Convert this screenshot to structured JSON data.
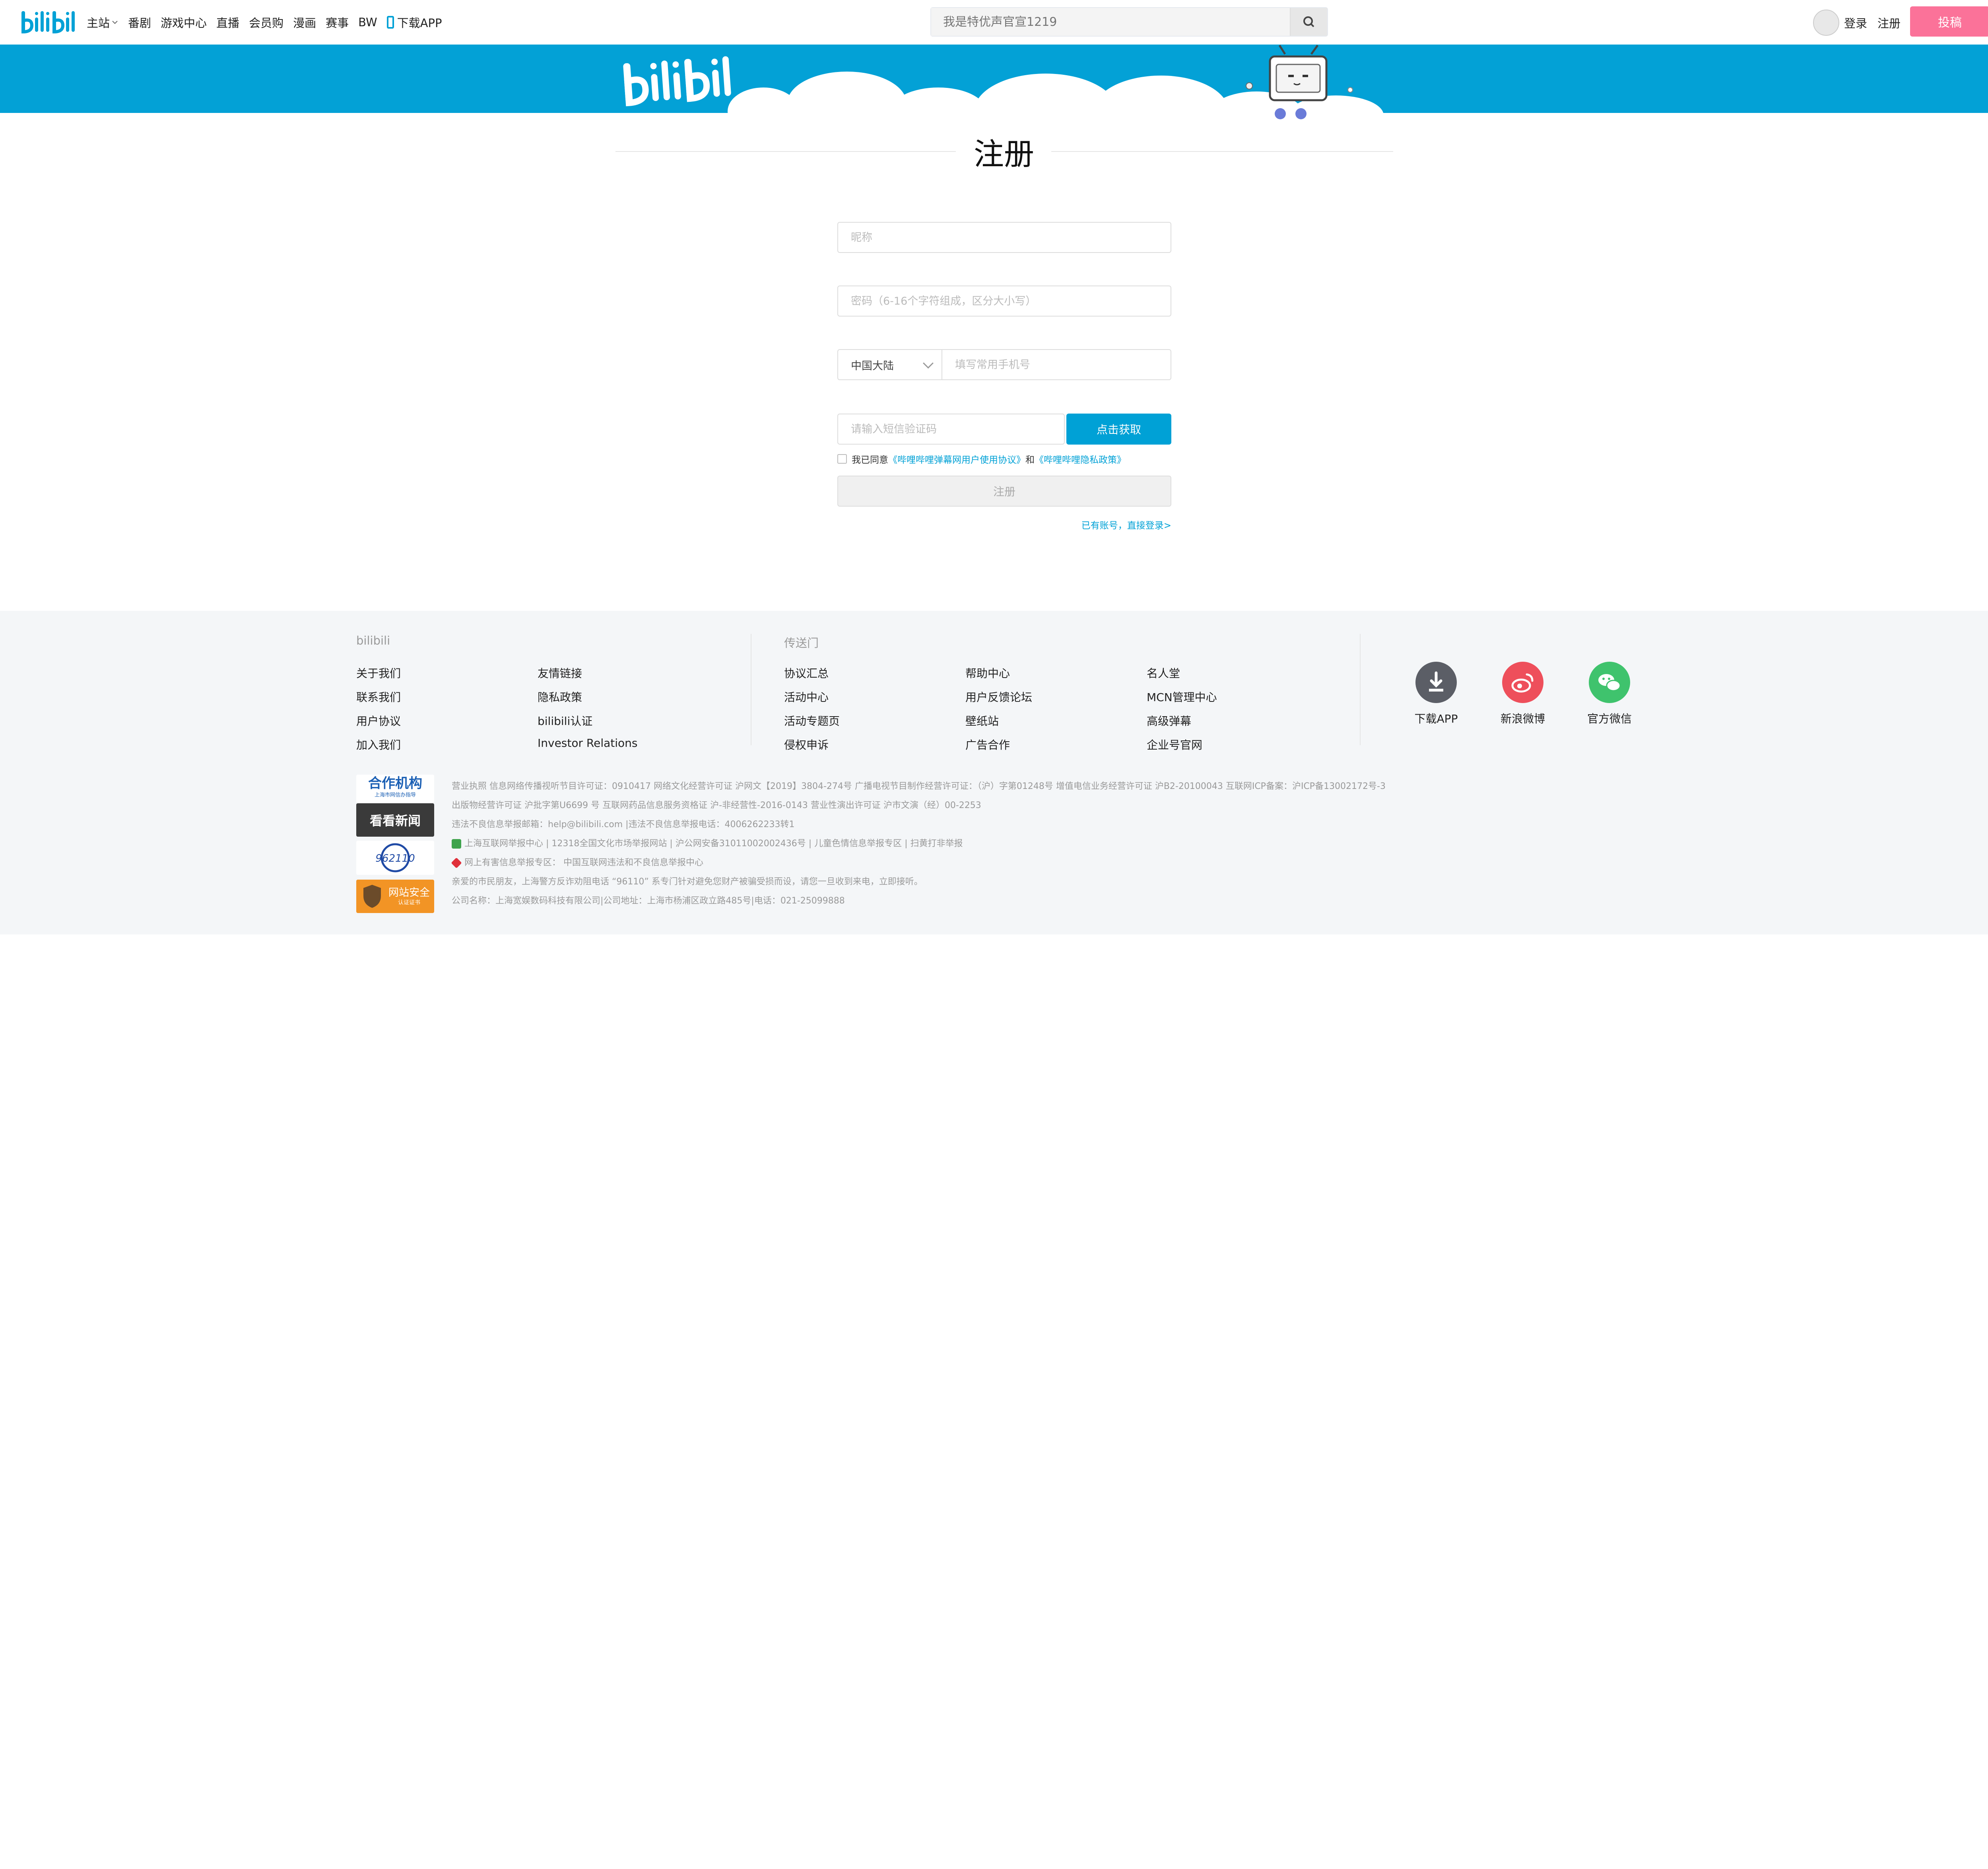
{
  "nav": {
    "brand": "bilibili",
    "items": [
      "主站",
      "番剧",
      "游戏中心",
      "直播",
      "会员购",
      "漫画",
      "赛事",
      "BW"
    ],
    "download_app": "下载APP",
    "search_placeholder": "我是特优声官宣1219",
    "login": "登录",
    "register": "注册",
    "upload": "投稿"
  },
  "page": {
    "title": "注册"
  },
  "form": {
    "nickname_placeholder": "昵称",
    "password_placeholder": "密码（6-16个字符组成，区分大小写）",
    "country": "中国大陆",
    "phone_placeholder": "填写常用手机号",
    "code_placeholder": "请输入短信验证码",
    "get_code": "点击获取",
    "agree_prefix": "我已同意",
    "agreement_link": "《哔哩哔哩弹幕网用户使用协议》",
    "agree_and": "和",
    "privacy_link": "《哔哩哔哩隐私政策》",
    "submit": "注册",
    "login_link": "已有账号，直接登录>"
  },
  "footer": {
    "col1_title": "bilibili",
    "col1_links": [
      "关于我们",
      "联系我们",
      "用户协议",
      "加入我们",
      "友情链接",
      "隐私政策",
      "bilibili认证",
      "Investor Relations"
    ],
    "col2_title": "传送门",
    "col2_links": [
      "协议汇总",
      "活动中心",
      "活动专题页",
      "侵权申诉",
      "帮助中心",
      "用户反馈论坛",
      "壁纸站",
      "广告合作",
      "名人堂",
      "MCN管理中心",
      "高级弹幕",
      "企业号官网"
    ],
    "social": [
      {
        "label": "下载APP",
        "icon": "download-icon",
        "color": "#5b5e66"
      },
      {
        "label": "新浪微博",
        "icon": "weibo-icon",
        "color": "#ee4f5b"
      },
      {
        "label": "官方微信",
        "icon": "wechat-icon",
        "color": "#3fc36d"
      }
    ],
    "badges": [
      "合作机构",
      "看看新闻",
      "962110",
      "网站安全"
    ],
    "badges_small": [
      "上海市网信办指导",
      "认证证书"
    ],
    "legal_lines": [
      "营业执照    信息网络传播视听节目许可证：0910417    网络文化经营许可证 沪网文【2019】3804-274号    广播电视节目制作经营许可证：（沪）字第01248号    增值电信业务经营许可证 沪B2-20100043    互联网ICP备案：沪ICP备13002172号-3",
      "出版物经营许可证 沪批字第U6699 号    互联网药品信息服务资格证 沪-非经营性-2016-0143    营业性演出许可证 沪市文演（经）00-2253",
      "违法不良信息举报邮箱：help@bilibili.com |违法不良信息举报电话：4006262233转1",
      "上海互联网举报中心 | 12318全国文化市场举报网站 |  沪公网安备31011002002436号 | 儿童色情信息举报专区 | 扫黄打非举报",
      "网上有害信息举报专区：  中国互联网违法和不良信息举报中心",
      "亲爱的市民朋友，上海警方反诈劝阻电话 “96110” 系专门针对避免您财产被骗受损而设，请您一旦收到来电，立即接听。",
      "公司名称：上海宽娱数码科技有限公司|公司地址：上海市杨浦区政立路485号|电话：021-25099888"
    ]
  },
  "colors": {
    "brand_blue": "#00a1d6",
    "banner_blue": "#03a1d6",
    "pink": "#fb7299"
  }
}
